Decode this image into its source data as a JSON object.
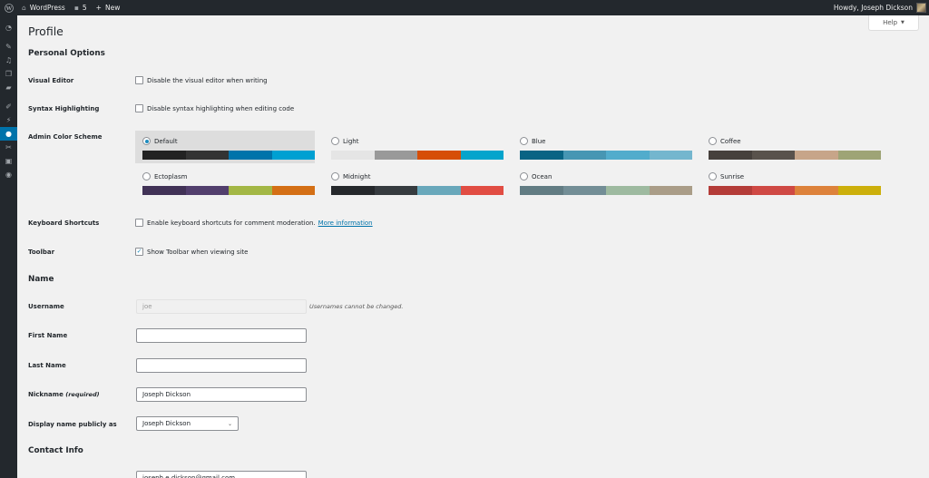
{
  "adminbar": {
    "site_name": "WordPress",
    "comments_count": "5",
    "new_label": "New",
    "howdy": "Howdy, Joseph Dickson"
  },
  "page": {
    "title": "Profile",
    "help_label": "Help"
  },
  "personal_options": {
    "title": "Personal Options",
    "visual_editor": {
      "label": "Visual Editor",
      "text": "Disable the visual editor when writing",
      "checked": false
    },
    "syntax": {
      "label": "Syntax Highlighting",
      "text": "Disable syntax highlighting when editing code",
      "checked": false
    },
    "color_scheme_label": "Admin Color Scheme",
    "schemes": [
      {
        "name": "Default",
        "selected": true,
        "colors": [
          "#222222",
          "#333333",
          "#0073aa",
          "#00a0d2"
        ]
      },
      {
        "name": "Light",
        "selected": false,
        "colors": [
          "#e5e5e5",
          "#999999",
          "#d64e07",
          "#04a4cc"
        ]
      },
      {
        "name": "Blue",
        "selected": false,
        "colors": [
          "#096484",
          "#4796b3",
          "#52accc",
          "#74b6ce"
        ]
      },
      {
        "name": "Coffee",
        "selected": false,
        "colors": [
          "#46403c",
          "#59524c",
          "#c7a589",
          "#9ea476"
        ]
      },
      {
        "name": "Ectoplasm",
        "selected": false,
        "colors": [
          "#413256",
          "#523f6d",
          "#a3b745",
          "#d46f15"
        ]
      },
      {
        "name": "Midnight",
        "selected": false,
        "colors": [
          "#25282b",
          "#363b3f",
          "#69a8bb",
          "#e14d43"
        ]
      },
      {
        "name": "Ocean",
        "selected": false,
        "colors": [
          "#627c83",
          "#738e96",
          "#9ebaa0",
          "#aa9d88"
        ]
      },
      {
        "name": "Sunrise",
        "selected": false,
        "colors": [
          "#b43c38",
          "#cf4944",
          "#dd823b",
          "#ccaf0b"
        ]
      }
    ],
    "shortcuts": {
      "label": "Keyboard Shortcuts",
      "text": "Enable keyboard shortcuts for comment moderation.",
      "link": "More information",
      "checked": false
    },
    "toolbar": {
      "label": "Toolbar",
      "text": "Show Toolbar when viewing site",
      "checked": true
    }
  },
  "name_section": {
    "title": "Name",
    "username": {
      "label": "Username",
      "value": "joe",
      "note": "Usernames cannot be changed."
    },
    "first_name": {
      "label": "First Name",
      "value": ""
    },
    "last_name": {
      "label": "Last Name",
      "value": ""
    },
    "nickname": {
      "label": "Nickname",
      "required": "(required)",
      "value": "Joseph Dickson"
    },
    "display_name": {
      "label": "Display name publicly as",
      "value": "Joseph Dickson"
    }
  },
  "contact": {
    "title": "Contact Info",
    "email_value": "joseph.e.dickson@gmail.com"
  },
  "colors": {
    "accent": "#0073aa",
    "adminbar_bg": "#23282d"
  }
}
